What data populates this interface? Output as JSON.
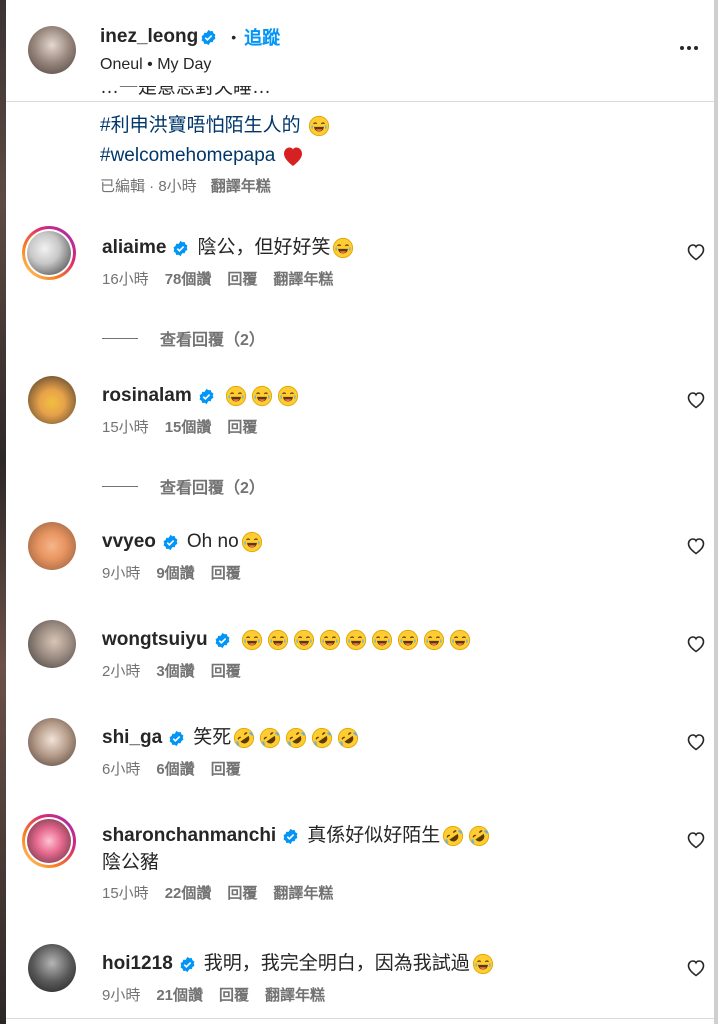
{
  "post": {
    "username": "inez_leong",
    "follow_label": "追蹤",
    "dot": "•",
    "subtitle": "Oneul • My Day"
  },
  "caption": {
    "cut_line": "…一是意思對天睡…",
    "hashtag1": "#利申洪寶唔怕陌生人的",
    "hashtag2": "#welcomehomepapa",
    "meta_edited": "已編輯 · 8小時",
    "meta_translate": "翻譯年糕"
  },
  "comments": [
    {
      "user": "aliaime",
      "text": "陰公，但好好笑",
      "emoji_count": 1,
      "emoji": "joy",
      "time": "16小時",
      "likes": "78個讚",
      "reply": "回覆",
      "translate": "翻譯年糕",
      "replies": "查看回覆（2）"
    },
    {
      "user": "rosinalam",
      "text": "",
      "emoji_count": 3,
      "emoji": "joy",
      "time": "15小時",
      "likes": "15個讚",
      "reply": "回覆",
      "translate": "",
      "replies": "查看回覆（2）"
    },
    {
      "user": "vvyeo",
      "text": "Oh no",
      "emoji_count": 1,
      "emoji": "joy",
      "time": "9小時",
      "likes": "9個讚",
      "reply": "回覆",
      "translate": "",
      "replies": ""
    },
    {
      "user": "wongtsuiyu",
      "text": "",
      "emoji_count": 9,
      "emoji": "joy",
      "time": "2小時",
      "likes": "3個讚",
      "reply": "回覆",
      "translate": "",
      "replies": ""
    },
    {
      "user": "shi_ga",
      "text": "笑死",
      "emoji_count": 5,
      "emoji": "rofl",
      "time": "6小時",
      "likes": "6個讚",
      "reply": "回覆",
      "translate": "",
      "replies": ""
    },
    {
      "user": "sharonchanmanchi",
      "text": "真係好似好陌生",
      "text2": "陰公豬",
      "emoji_count": 2,
      "emoji": "rofl",
      "time": "15小時",
      "likes": "22個讚",
      "reply": "回覆",
      "translate": "翻譯年糕",
      "replies": ""
    },
    {
      "user": "hoi1218",
      "text": "我明，我完全明白，因為我試過",
      "emoji_count": 1,
      "emoji": "joy",
      "time": "9小時",
      "likes": "21個讚",
      "reply": "回覆",
      "translate": "翻譯年糕",
      "replies": ""
    }
  ],
  "colors": {
    "link_blue": "#0095f6",
    "hashtag_blue": "#00376b",
    "verified_blue": "#0095f6",
    "meta_gray": "#737373",
    "heart_red": "#ed4956"
  },
  "icons": {
    "verified": "verified-badge-icon",
    "heart": "heart-outline-icon",
    "more": "more-options-icon",
    "joy": "face-with-tears-of-joy",
    "rofl": "rolling-on-floor-laughing"
  }
}
